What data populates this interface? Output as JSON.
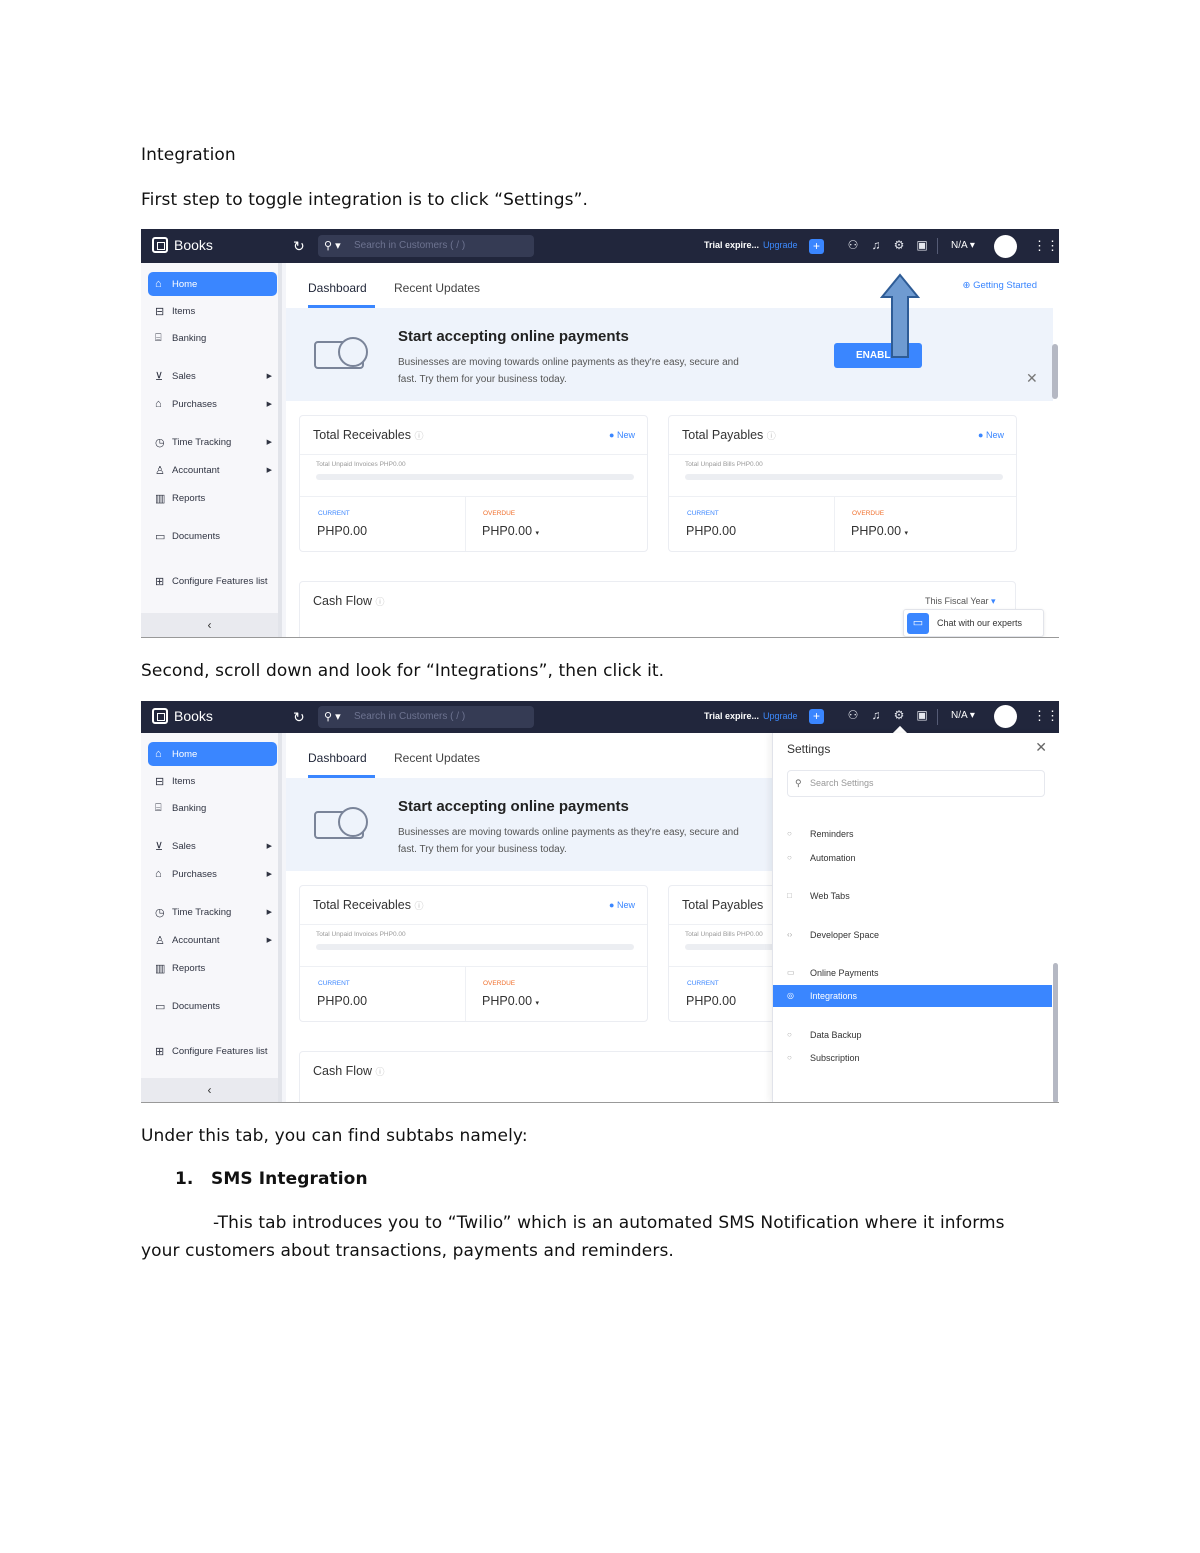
{
  "doc": {
    "title": "Integration",
    "step1": "First step to toggle integration is to click “Settings”.",
    "step2": "Second, scroll down and look for “Integrations”, then click it.",
    "under": "Under this tab, you can find subtabs namely:",
    "list": [
      {
        "number": "1.",
        "heading": "SMS Integration",
        "desc_line1": "-This tab introduces you to “Twilio” which is an automated SMS Notification where it informs",
        "desc_line2": "your customers about transactions, payments and reminders."
      }
    ]
  },
  "app": {
    "brand": "Books",
    "search_placeholder": "Search in Customers ( / )",
    "trial": "Trial expire...",
    "upgrade": "Upgrade",
    "org": "N/A",
    "accent_color": "#3a86ff",
    "topbar_color": "#21263c"
  },
  "sidebar": {
    "items": [
      {
        "label": "Home",
        "icon": "home-icon",
        "active": true
      },
      {
        "label": "Items",
        "icon": "box-icon"
      },
      {
        "label": "Banking",
        "icon": "bank-icon"
      },
      {
        "label": "Sales",
        "icon": "cart-icon",
        "submenu": true
      },
      {
        "label": "Purchases",
        "icon": "bag-icon",
        "submenu": true
      },
      {
        "label": "Time Tracking",
        "icon": "clock-icon",
        "submenu": true
      },
      {
        "label": "Accountant",
        "icon": "person-icon",
        "submenu": true
      },
      {
        "label": "Reports",
        "icon": "bar-chart-icon"
      },
      {
        "label": "Documents",
        "icon": "folder-icon"
      },
      {
        "label": "Configure Features list",
        "icon": "grid-icon"
      }
    ],
    "collapse": "‹"
  },
  "dashboard": {
    "tabs": [
      "Dashboard",
      "Recent Updates"
    ],
    "getting_started": "Getting Started",
    "banner_title": "Start accepting online payments",
    "banner_desc": "Businesses are moving towards online payments as they're easy, secure and fast. Try them for your business today.",
    "enable": "ENABL...",
    "receivables": {
      "title": "Total Receivables",
      "new": "New",
      "sub": "Total Unpaid Invoices PHP0.00",
      "current_label": "CURRENT",
      "current": "PHP0.00",
      "overdue_label": "OVERDUE",
      "overdue": "PHP0.00"
    },
    "payables": {
      "title": "Total Payables",
      "new": "New",
      "sub": "Total Unpaid Bills PHP0.00",
      "current_label": "CURRENT",
      "current": "PHP0.00",
      "overdue_label": "OVERDUE",
      "overdue": "PHP0.00"
    },
    "cashflow": "Cash Flow",
    "fiscal": "This Fiscal Year",
    "chat": "Chat with our experts"
  },
  "settings_panel": {
    "title": "Settings",
    "search_placeholder": "Search Settings",
    "items": [
      {
        "label": "Reminders"
      },
      {
        "label": "Automation"
      },
      {
        "label": "Web Tabs"
      },
      {
        "label": "Developer Space"
      },
      {
        "label": "Online Payments"
      },
      {
        "label": "Integrations",
        "active": true
      },
      {
        "label": "Data Backup"
      },
      {
        "label": "Subscription"
      }
    ]
  }
}
